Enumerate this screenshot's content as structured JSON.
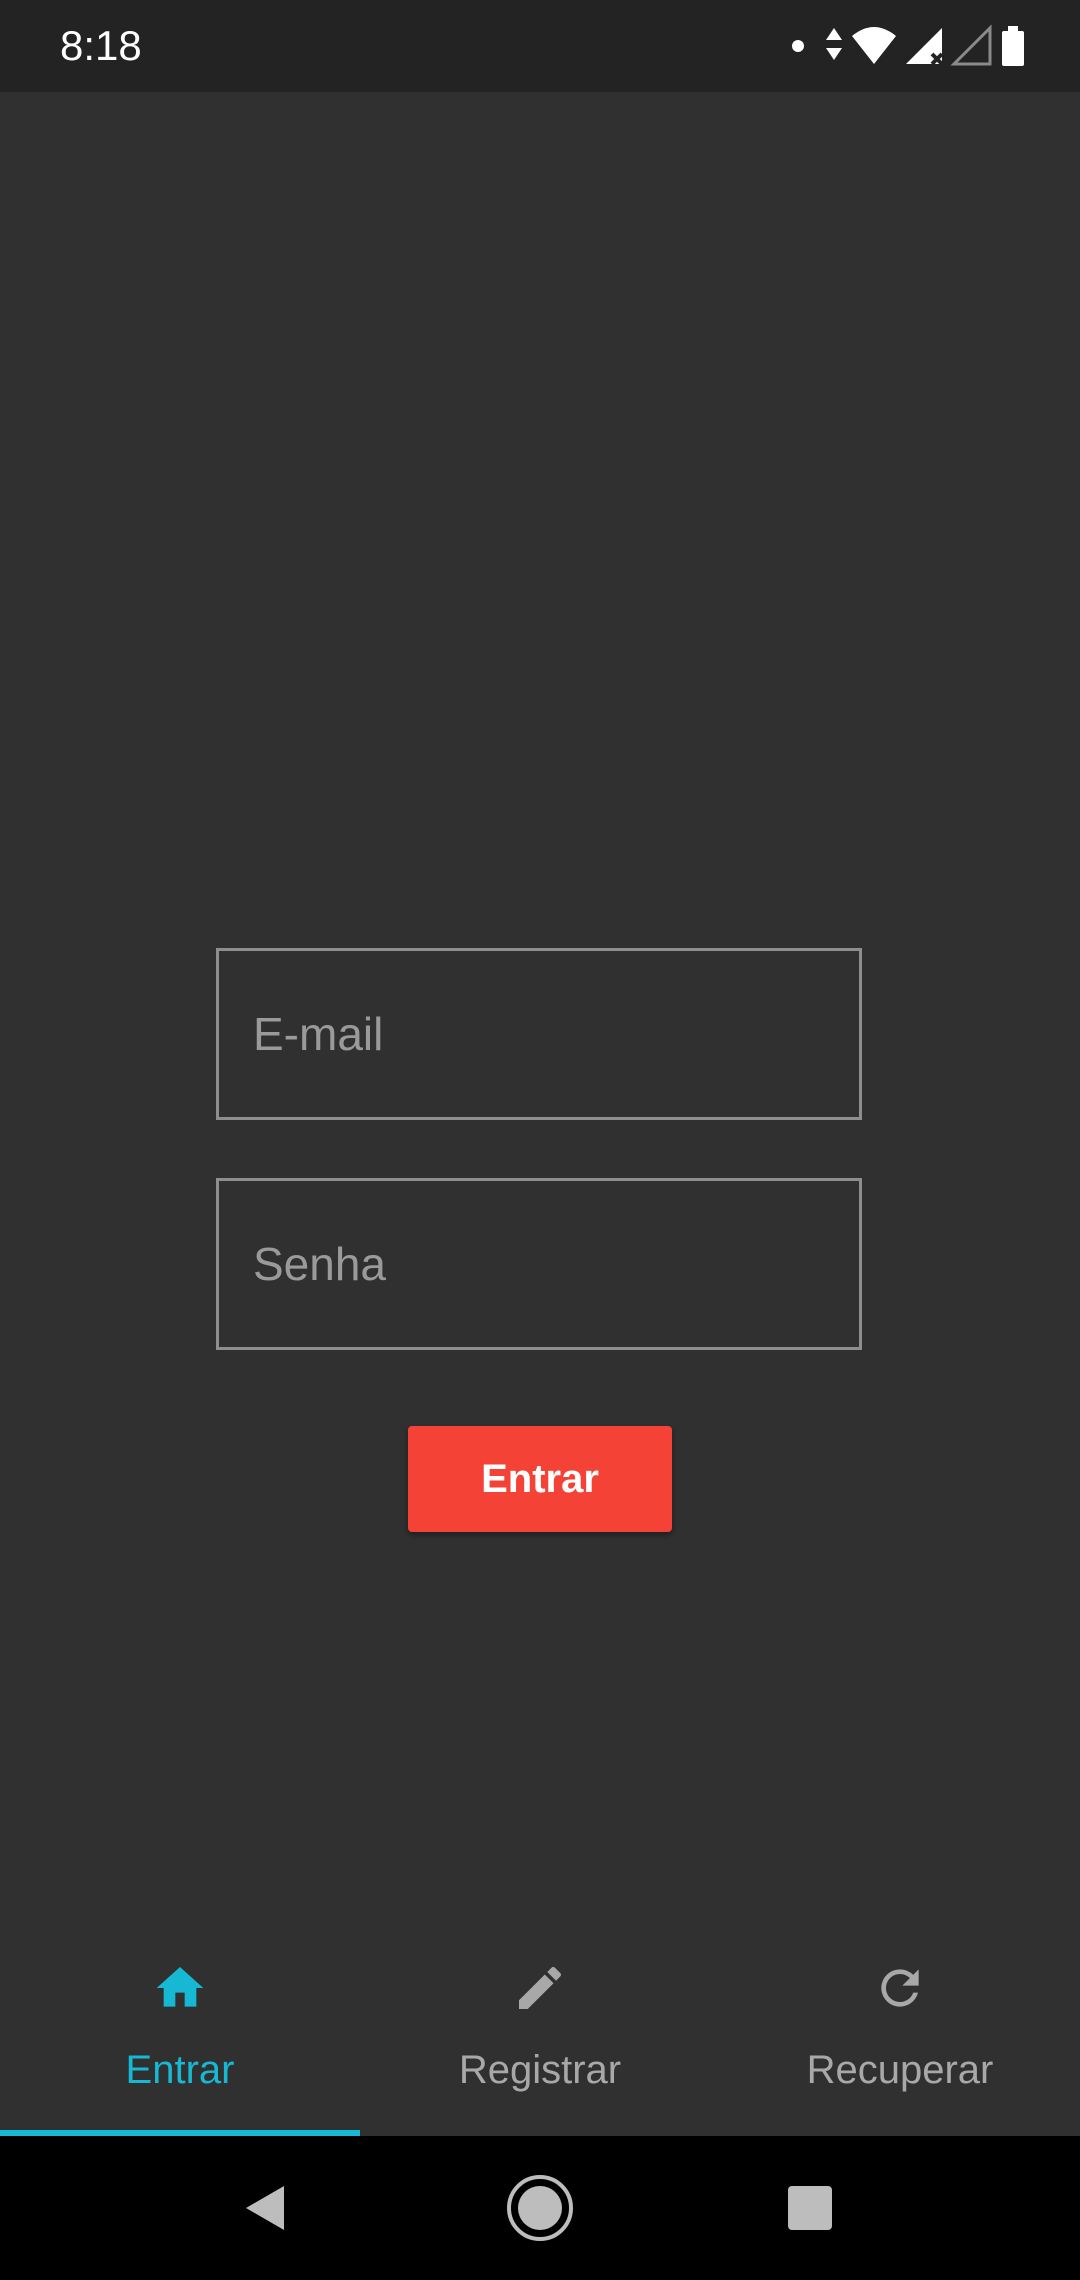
{
  "status_bar": {
    "time": "8:18",
    "icons": [
      "notification-dot-icon",
      "data-arrows-icon",
      "wifi-icon",
      "signal-icon",
      "signal-empty-icon",
      "battery-icon"
    ]
  },
  "form": {
    "email_placeholder": "E-mail",
    "email_value": "",
    "password_placeholder": "Senha",
    "password_value": "",
    "submit_label": "Entrar",
    "submit_color": "#f44336"
  },
  "tabs": [
    {
      "label": "Entrar",
      "icon": "home-icon",
      "active": true
    },
    {
      "label": "Registrar",
      "icon": "pencil-icon",
      "active": false
    },
    {
      "label": "Recuperar",
      "icon": "refresh-icon",
      "active": false
    }
  ],
  "colors": {
    "background": "#303030",
    "accent": "#16b8d3",
    "inactive": "#a8a8a8"
  },
  "nav_bar": {
    "buttons": [
      "back-icon",
      "home-circle-icon",
      "recents-icon"
    ]
  }
}
